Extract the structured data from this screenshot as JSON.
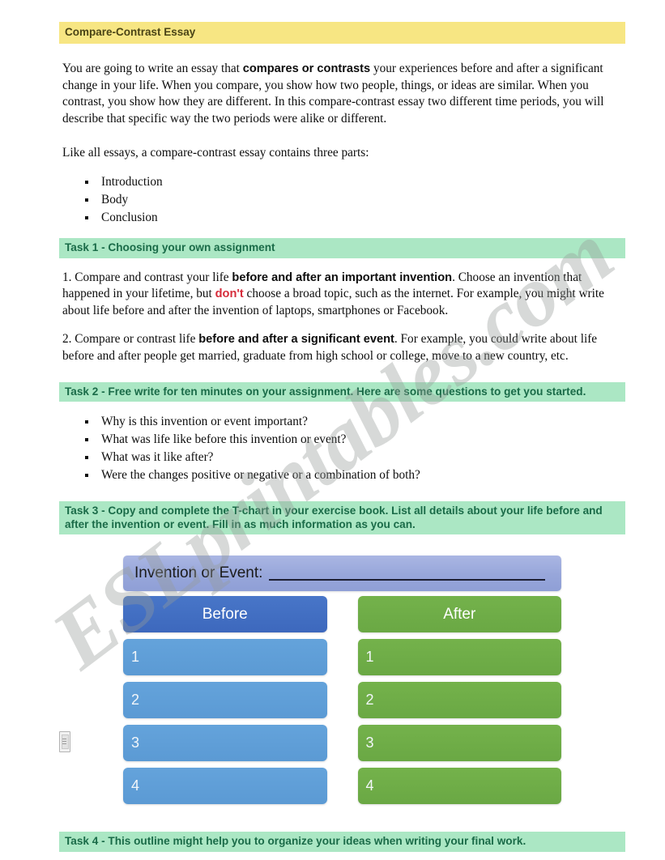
{
  "document": {
    "title": "Compare-Contrast Essay",
    "intro": {
      "lead_a": "You are going to write an essay that ",
      "lead_bold": "compares or contrasts",
      "lead_b": " your experiences before and after a significant change in your life. When you compare, you show how two people, things, or ideas are similar. When you contrast, you show how they are different. In this compare-contrast essay two different time periods, you will describe that specific way the two periods were alike or different."
    },
    "parts_intro": "Like all essays, a compare-contrast essay contains three parts:",
    "parts": [
      "Introduction",
      "Body",
      "Conclusion"
    ],
    "tasks": {
      "task1": {
        "heading": "Task 1 - Choosing your own assignment",
        "item1_a": "1. Compare and contrast your life ",
        "item1_bold": "before and after an important invention",
        "item1_b": ". Choose an invention that happened in your lifetime, but ",
        "item1_red": "don't",
        "item1_c": " choose a broad topic, such as the internet. For example, you might write about life before and after the invention of laptops, smartphones or Facebook.",
        "item2_a": "2. Compare or contrast life ",
        "item2_bold": "before and after a significant event",
        "item2_b": ". For example, you could write about life before and after people get married, graduate from high school or college, move to a new country, etc."
      },
      "task2": {
        "heading": "Task 2 - Free write for ten minutes on your assignment. Here are some questions to get you started.",
        "questions": [
          "Why is this invention or event important?",
          "What was life like before this invention or event?",
          "What was it like after?",
          "Were the changes positive or negative or a combination of both?"
        ]
      },
      "task3": {
        "heading": "Task 3 - Copy and complete the T-chart in your exercise book. List all details about your life before and after the invention or event. Fill in as much information as you can."
      },
      "task4": {
        "heading": "Task 4 - This outline might help you to organize your ideas when writing your final work."
      }
    },
    "tchart": {
      "invention_label": "Invention or Event:",
      "before_header": "Before",
      "after_header": "After",
      "before_rows": [
        "1",
        "2",
        "3",
        "4"
      ],
      "after_rows": [
        "1",
        "2",
        "3",
        "4"
      ]
    },
    "watermark": "ESLprintables.com",
    "colors": {
      "title_band": "#f7e683",
      "task_band": "#abe7c4",
      "task_text": "#1a6b48",
      "red_accent": "#d62b3a",
      "before_header": "#4472c4",
      "before_row": "#5b9bd5",
      "after": "#70ad47",
      "invention_box": "#9fb0de"
    }
  }
}
